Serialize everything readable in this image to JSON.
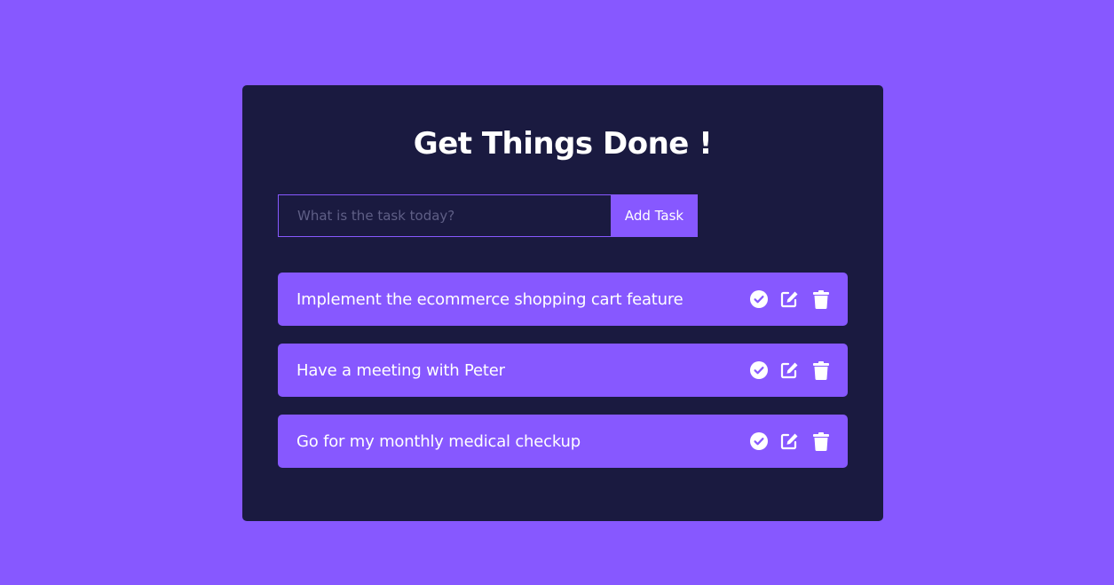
{
  "app": {
    "title": "Get Things Done !"
  },
  "form": {
    "input_value": "",
    "input_placeholder": "What is the task today?",
    "add_button_label": "Add Task"
  },
  "todos": [
    {
      "text": "Implement the ecommerce shopping cart feature"
    },
    {
      "text": "Have a meeting with Peter"
    },
    {
      "text": "Go for my monthly medical checkup"
    }
  ],
  "icons": {
    "complete": "check-circle-icon",
    "edit": "edit-icon",
    "delete": "trash-icon"
  },
  "colors": {
    "background": "#8758ff",
    "card": "#1a1a40",
    "accent": "#8758ff",
    "text": "#ffffff",
    "placeholder": "#5f5f86"
  }
}
